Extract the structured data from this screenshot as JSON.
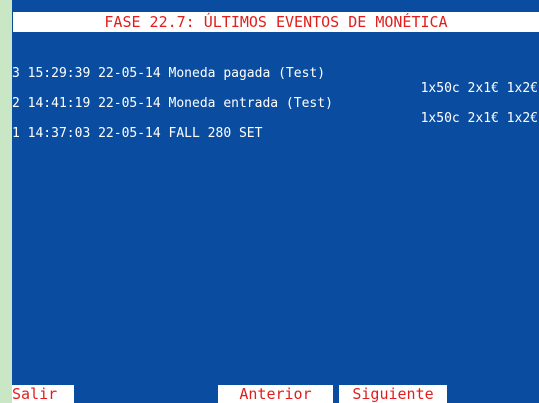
{
  "title": "FASE 22.7: ÚLTIMOS EVENTOS DE MONÉTICA",
  "events": [
    {
      "line": "3 15:29:39 22-05-14 Moneda pagada (Test)",
      "detail": "1x50c 2x1€ 1x2€"
    },
    {
      "line": "2 14:41:19 22-05-14 Moneda entrada (Test)",
      "detail": "1x50c 2x1€ 1x2€"
    },
    {
      "line": "1 14:37:03 22-05-14 FALL 280 SET"
    }
  ],
  "buttons": {
    "salir": "Salir",
    "anterior": "Anterior",
    "siguiente": "Siguiente"
  },
  "colors": {
    "screen_background": "#0a4da0",
    "outer_background": "#c9e7c4",
    "label_text": "#e01e1e",
    "label_background": "#ffffff",
    "text": "#ffffff"
  }
}
